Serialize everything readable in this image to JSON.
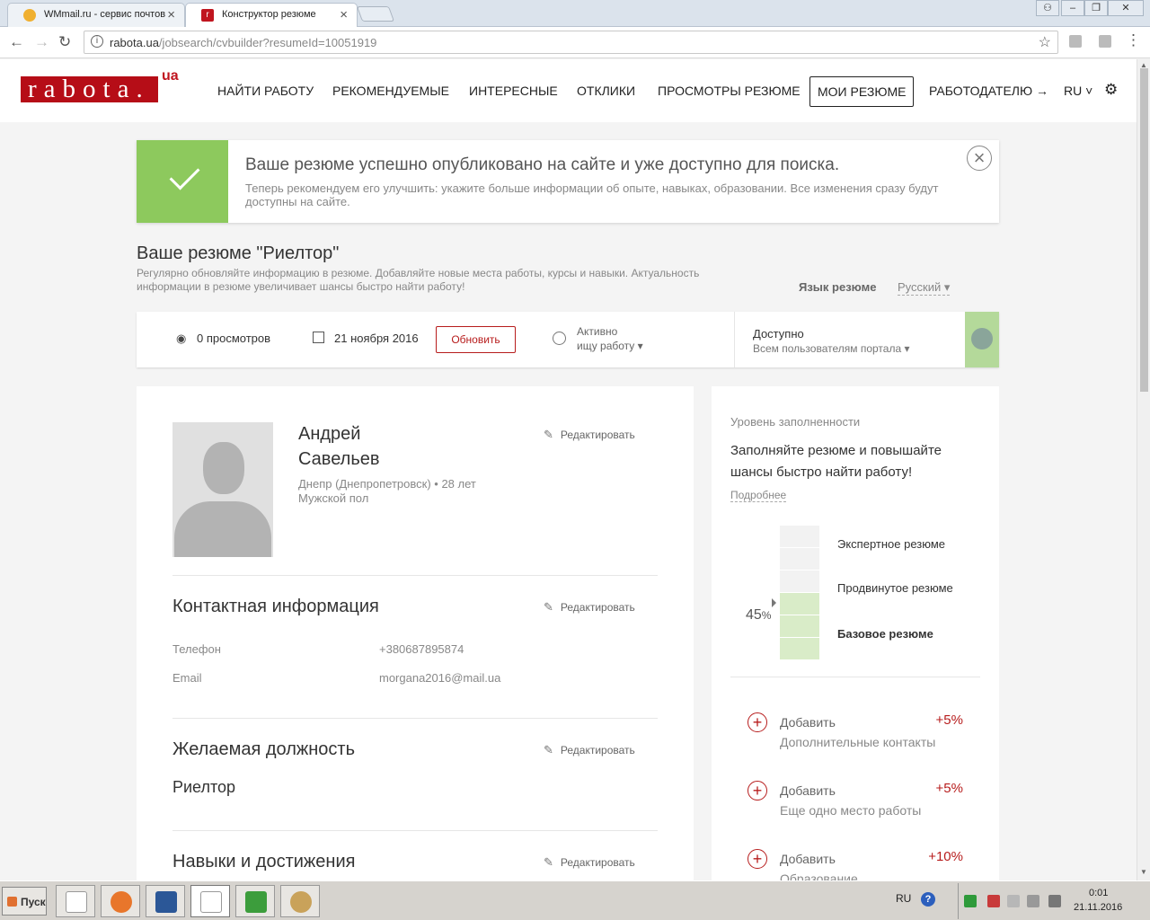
{
  "browser": {
    "tabs": [
      {
        "title": "WMmail.ru - сервис почтов",
        "favicon_color": "#f0b030"
      },
      {
        "title": "Конструктор резюме",
        "favicon_color": "#c0151f"
      }
    ],
    "url_host": "rabota.ua",
    "url_path": "/jobsearch/cvbuilder?resumeId=10051919"
  },
  "site": {
    "logo": "rabota.",
    "logo_suffix": "ua",
    "nav": [
      "НАЙТИ РАБОТУ",
      "РЕКОМЕНДУЕМЫЕ",
      "ИНТЕРЕСНЫЕ",
      "ОТКЛИКИ",
      "ПРОСМОТРЫ РЕЗЮМЕ",
      "МОИ РЕЗЮМЕ",
      "РАБОТОДАТЕЛЮ →",
      "RU ˅"
    ],
    "nav_active_index": 5
  },
  "alert": {
    "title": "Ваше резюме успешно опубликовано на сайте и уже доступно для поиска.",
    "text": "Теперь рекомендуем его улучшить: укажите больше информации об опыте, навыках, образовании. Все изменения сразу будут доступны на сайте.",
    "close": "×"
  },
  "resume": {
    "title": "Ваше резюме \"Риелтор\"",
    "subtitle": "Регулярно обновляйте информацию в резюме. Добавляйте новые места работы, курсы и навыки. Актуальность информации в резюме увеличивает шансы быстро найти работу!",
    "lang_label": "Язык резюме",
    "lang_value": "Русский ▾",
    "views": "0 просмотров",
    "date": "21 ноября 2016",
    "update_btn": "Обновить",
    "status_line1": "Активно",
    "status_line2": "ищу работу ▾",
    "avail_line1": "Доступно",
    "avail_line2": "Всем пользователям портала ▾"
  },
  "profile": {
    "first_name": "Андрей",
    "last_name": "Савельев",
    "city_age": "Днепр (Днепропетровск) • 28 лет",
    "gender": "Мужской пол",
    "edit_label": "Редактировать"
  },
  "contacts": {
    "heading": "Контактная информация",
    "phone_label": "Телефон",
    "phone": "+380687895874",
    "email_label": "Email",
    "email": "morgana2016@mail.ua"
  },
  "position": {
    "heading": "Желаемая должность",
    "value": "Риелтор"
  },
  "skills": {
    "heading": "Навыки и достижения"
  },
  "completeness": {
    "title": "Уровень заполненности",
    "text": "Заполняйте резюме и повышайте шансы быстро найти работу!",
    "more": "Подробнее",
    "percent": 45,
    "percent_sign": "%",
    "levels": [
      "Экспертное резюме",
      "Продвинутое резюме",
      "Базовое резюме"
    ],
    "fill_color": "#d9ecc8",
    "empty_color": "#f2f2f2",
    "add_items": [
      {
        "action": "Добавить",
        "what": "Дополнительные контакты",
        "gain": "+5%"
      },
      {
        "action": "Добавить",
        "what": "Еще одно место работы",
        "gain": "+5%"
      },
      {
        "action": "Добавить",
        "what": "Образование",
        "gain": "+10%"
      }
    ]
  },
  "taskbar": {
    "start": "Пуск",
    "lang": "RU",
    "help": "?",
    "time": "0:01",
    "date": "21.11.2016"
  }
}
